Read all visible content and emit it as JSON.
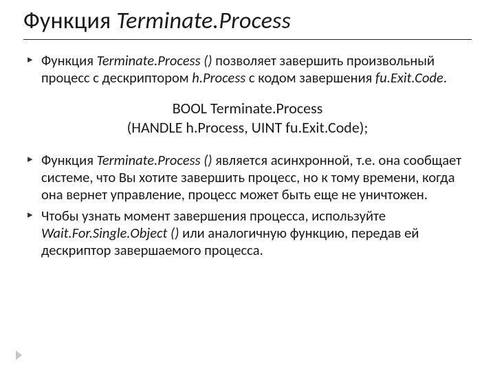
{
  "title": {
    "prefix": "Функция ",
    "funcName": "Terminate.Process"
  },
  "bullets1": [
    {
      "seg1": "Функция ",
      "seg2_it": "Terminate.Process ()",
      "seg3": " позволяет завершить произвольный процесс с дескриптором ",
      "seg4_it": "h.Process",
      "seg5": " с кодом завершения ",
      "seg6_it": "fu.Exit.Code",
      "seg7": "."
    }
  ],
  "code": {
    "line1": "BOOL Terminate.Process",
    "line2": "(HANDLE h.Process, UINT fu.Exit.Code);"
  },
  "bullets2": [
    {
      "seg1": "Функция ",
      "seg2_it": "Terminate.Process ()",
      "seg3": " является асинхронной, т.е. она сообщает системе, что Вы хотите завершить процесс, но к тому времени, когда она вернет управление, процесс может быть еще не уничтожен."
    },
    {
      "seg1": "Чтобы узнать момент завершения процесса, используйте ",
      "seg2_it": "Wait.For.Single.Object ()",
      "seg3": " или аналогичную функцию, передав ей дескриптор завершаемого процесса."
    }
  ]
}
